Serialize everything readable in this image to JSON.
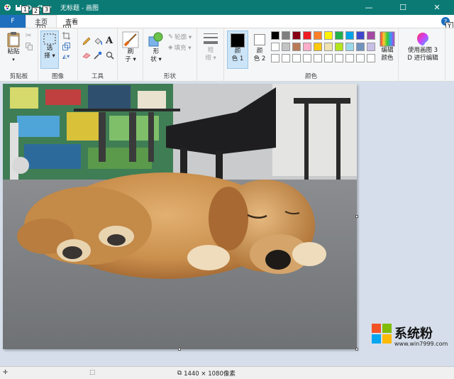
{
  "window": {
    "title": "无标题 - 画图",
    "controls": {
      "minimize": "—",
      "maximize": "☐",
      "close": "✕"
    }
  },
  "keytips": {
    "file": "F",
    "home": "H",
    "view": "V",
    "qa1": "1",
    "qa2": "2",
    "qa3": "3",
    "help": "Y"
  },
  "tabs": {
    "file": "F",
    "home": "主页",
    "view": "查看"
  },
  "ribbon": {
    "clipboard": {
      "paste": "粘贴",
      "label": "剪贴板"
    },
    "image": {
      "select_line1": "选",
      "select_line2": "择 ▾",
      "label": "图像"
    },
    "tools": {
      "label": "工具"
    },
    "brushes": {
      "line1": "刷",
      "line2": "子 ▾"
    },
    "shapes": {
      "shape_line1": "形",
      "shape_line2": "状 ▾",
      "outline": "轮廓 ▾",
      "fill": "填充 ▾",
      "label": "形状"
    },
    "size": {
      "line1": "粗",
      "line2": "细 ▾"
    },
    "colors": {
      "color1_line1": "颜",
      "color1_line2": "色 1",
      "color2_line1": "颜",
      "color2_line2": "色 2",
      "edit_line1": "编辑",
      "edit_line2": "颜色",
      "label": "颜色",
      "color1_value": "#000000",
      "color2_value": "#ffffff",
      "palette_row1": [
        "#000000",
        "#7f7f7f",
        "#880015",
        "#ed1c24",
        "#ff7f27",
        "#fff200",
        "#22b14c",
        "#00a2e8",
        "#3f48cc",
        "#a349a4"
      ],
      "palette_row2": [
        "#ffffff",
        "#c3c3c3",
        "#b97a57",
        "#ffaec9",
        "#ffc90e",
        "#efe4b0",
        "#b5e61d",
        "#99d9ea",
        "#7092be",
        "#c8bfe7"
      ],
      "palette_row3": [
        "#ffffff",
        "#ffffff",
        "#ffffff",
        "#ffffff",
        "#ffffff",
        "#ffffff",
        "#ffffff",
        "#ffffff",
        "#ffffff",
        "#ffffff"
      ]
    },
    "paint3d": {
      "line1": "使用画图 3",
      "line2": "D 进行编辑"
    }
  },
  "status": {
    "image_size": "1440 × 1080像素"
  },
  "watermark": {
    "brand": "系统粉",
    "url": "www.win7999.com"
  }
}
